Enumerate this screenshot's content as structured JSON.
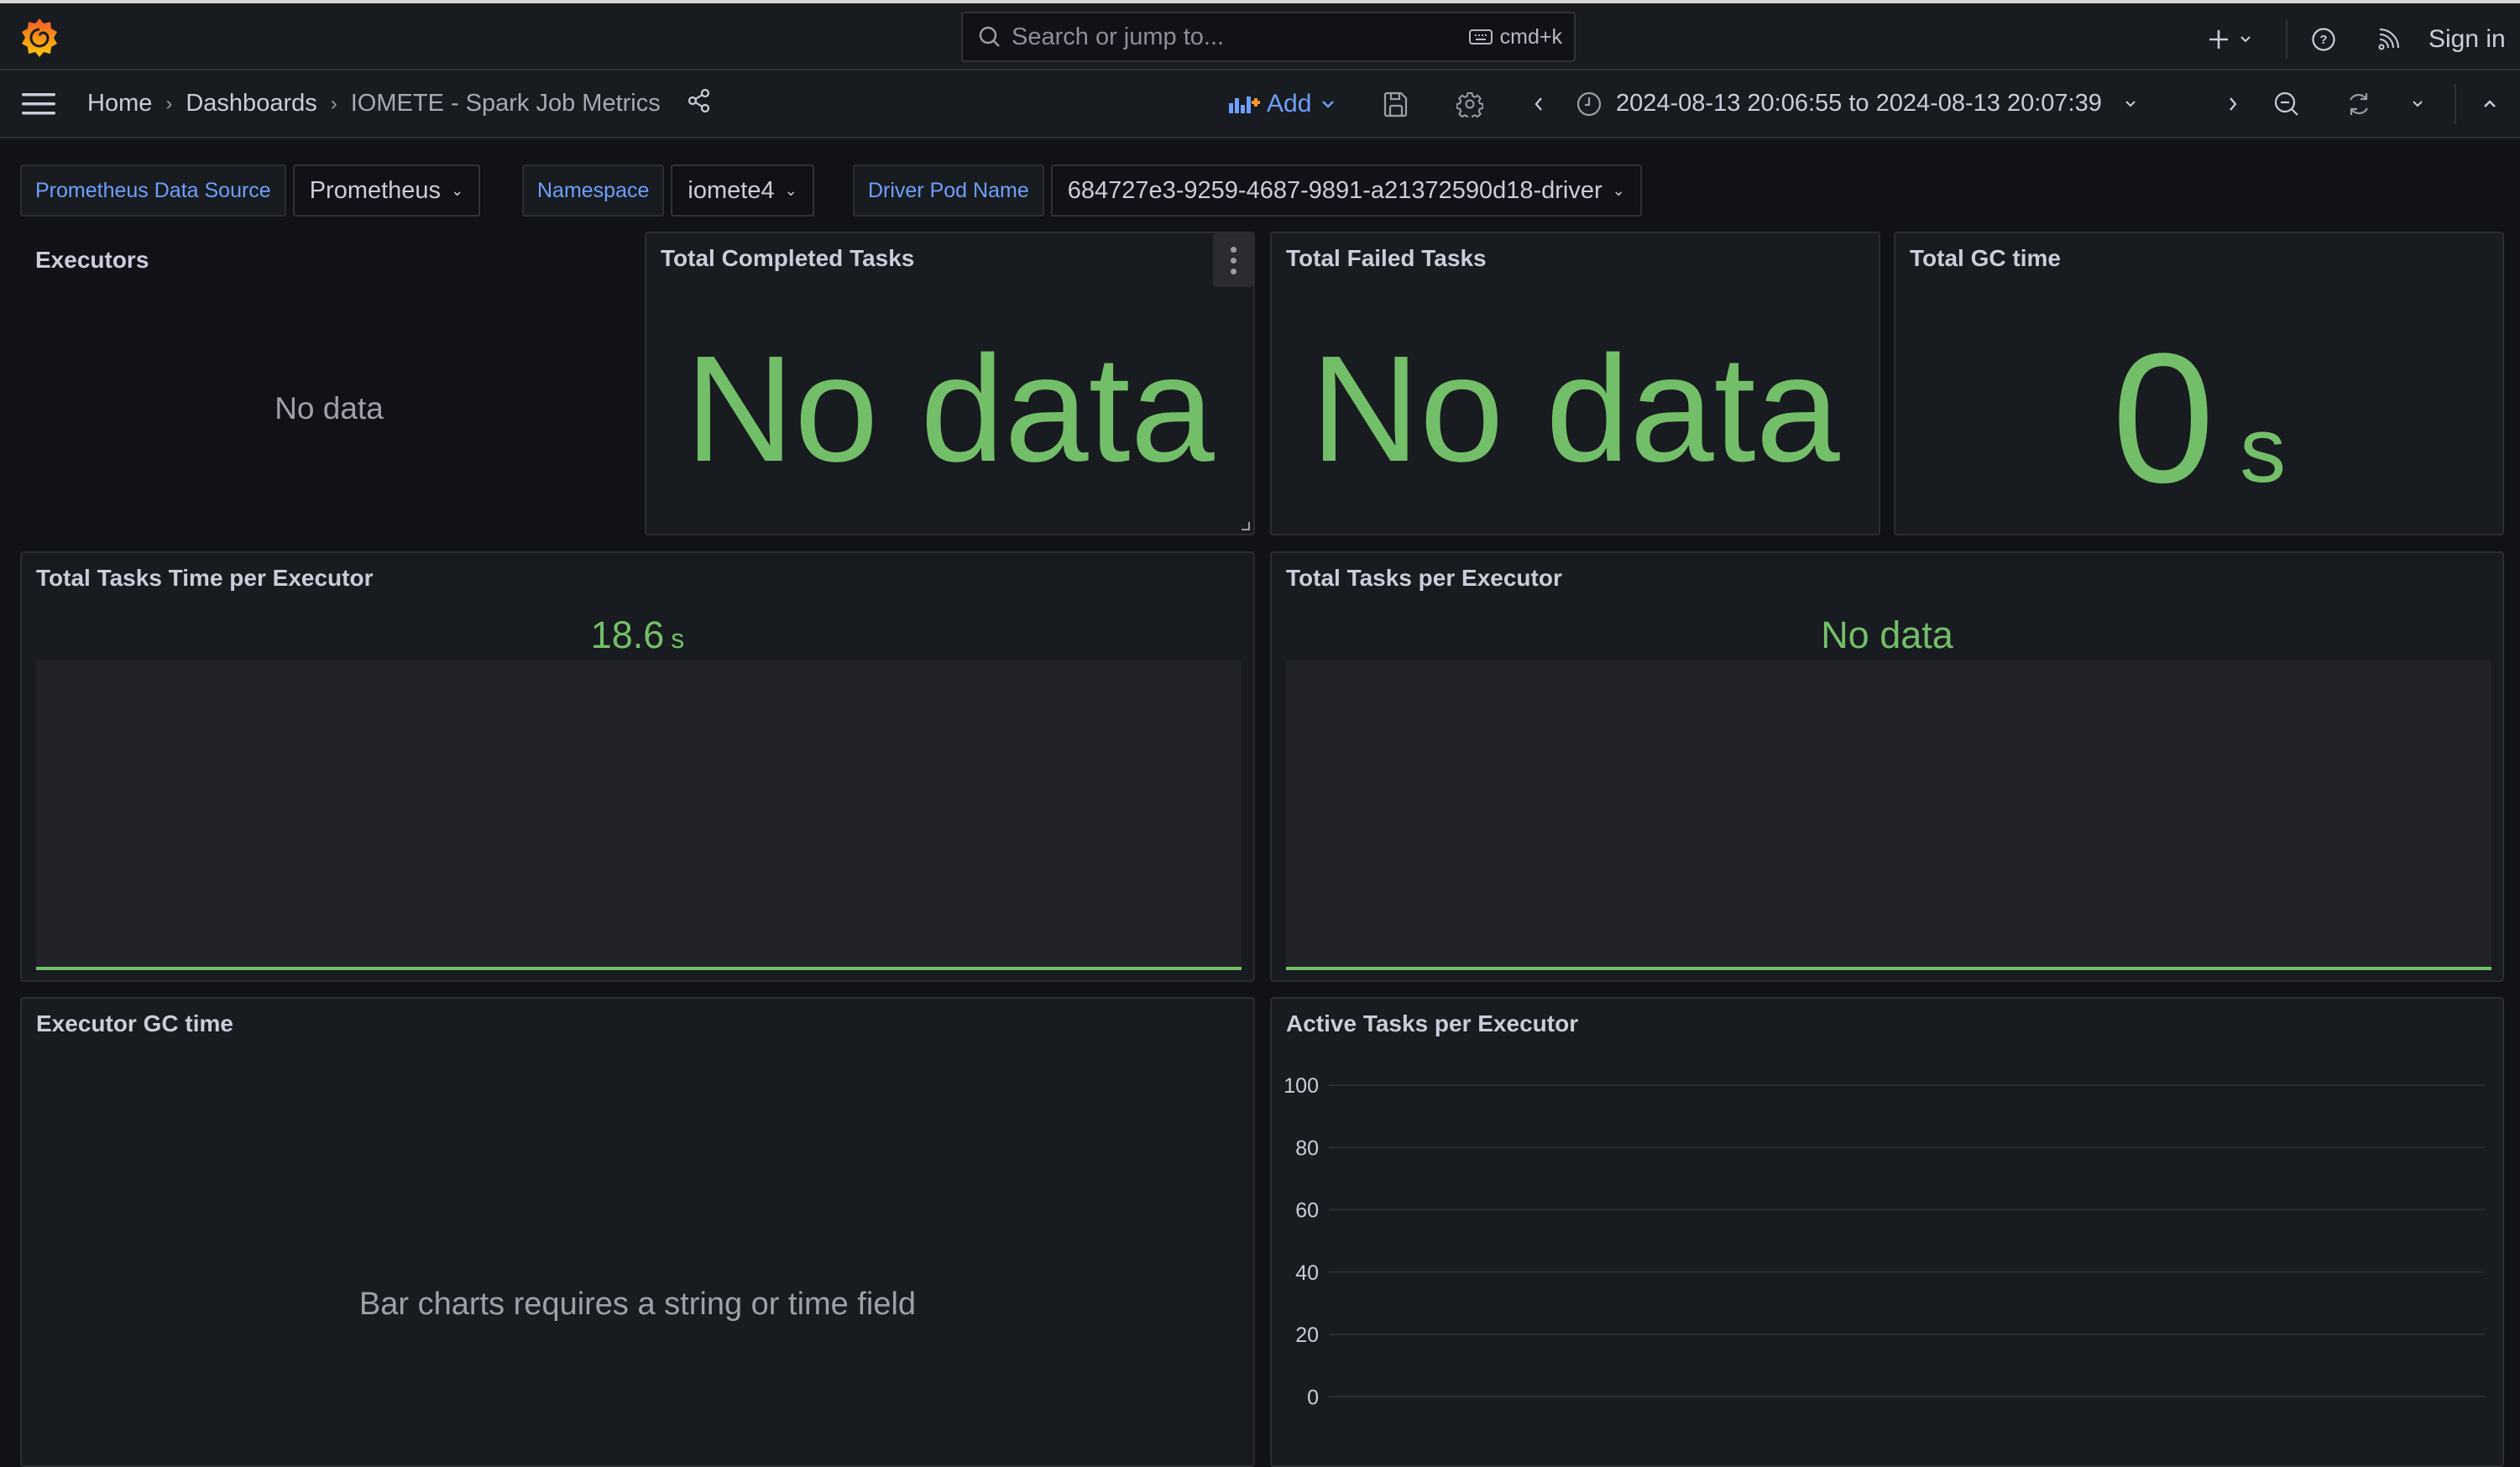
{
  "topbar": {
    "search_placeholder": "Search or jump to...",
    "search_shortcut": "cmd+k",
    "sign_in": "Sign in",
    "icons": [
      "grafana-logo",
      "search-icon",
      "keyboard-icon",
      "plus-icon",
      "help-icon",
      "rss-icon"
    ]
  },
  "breadcrumb": {
    "items": [
      "Home",
      "Dashboards",
      "IOMETE - Spark Job Metrics"
    ],
    "separator": "›"
  },
  "toolbar": {
    "add_label": "Add",
    "time_range": "2024-08-13 20:06:55 to 2024-08-13 20:07:39",
    "accent_color": "#6e9fff"
  },
  "variables": [
    {
      "label": "Prometheus Data Source",
      "value": "Prometheus"
    },
    {
      "label": "Namespace",
      "value": "iomete4"
    },
    {
      "label": "Driver Pod Name",
      "value": "684727e3-9259-4687-9891-a21372590d18-driver"
    }
  ],
  "panels": {
    "executors": {
      "title": "Executors",
      "message": "No data"
    },
    "completed": {
      "title": "Total Completed Tasks",
      "value": "No data"
    },
    "failed": {
      "title": "Total Failed Tasks",
      "value": "No data"
    },
    "gc_total": {
      "title": "Total GC time",
      "value": "0",
      "unit": "s"
    },
    "tasks_time": {
      "title": "Total Tasks Time per Executor",
      "value": "18.6",
      "unit": "s"
    },
    "tasks_per_exec": {
      "title": "Total Tasks per Executor",
      "value": "No data"
    },
    "executor_gc": {
      "title": "Executor GC time",
      "message": "Bar charts requires a string or time field"
    },
    "active_tasks": {
      "title": "Active Tasks per Executor"
    }
  },
  "colors": {
    "value_green": "#73bf69",
    "background": "#111217",
    "panel": "#181b1f"
  },
  "chart_data": {
    "type": "line",
    "title": "Active Tasks per Executor",
    "xlabel": "",
    "ylabel": "",
    "ylim": [
      0,
      100
    ],
    "yticks": [
      100,
      80,
      60,
      40,
      20
    ],
    "grid": true,
    "series": []
  }
}
